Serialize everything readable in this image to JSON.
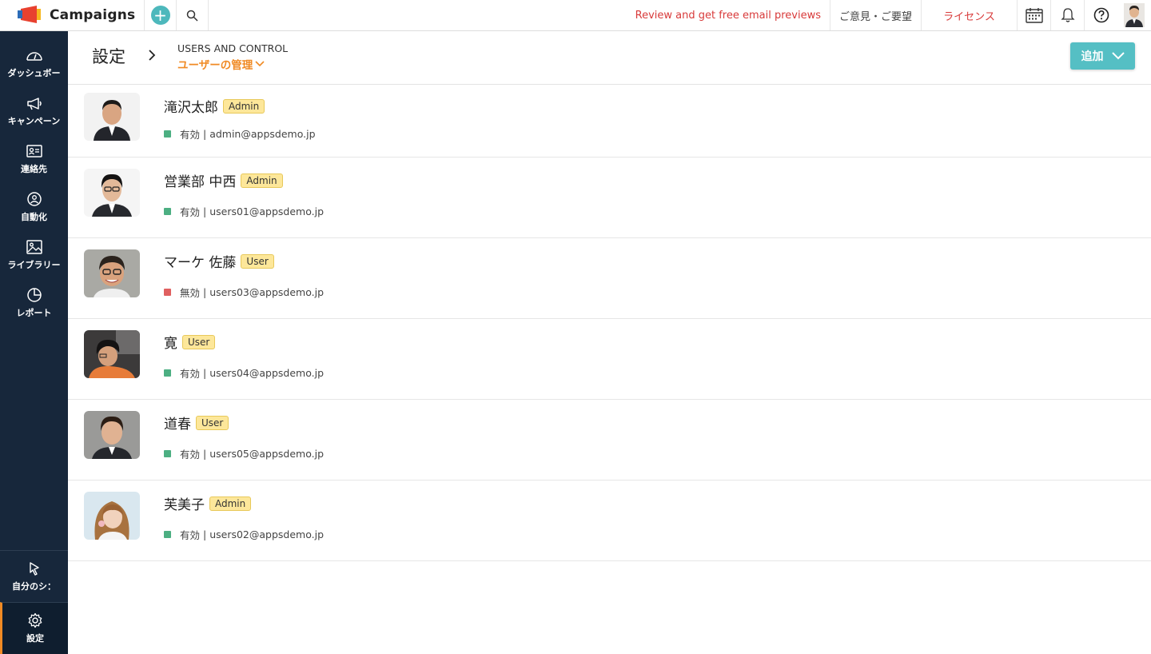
{
  "topbar": {
    "app_name": "Campaigns",
    "promo_link": "Review and get free email previews",
    "feedback": "ご意見・ご要望",
    "license": "ライセンス",
    "accent_color": "#4db8bc",
    "alert_color": "#d83a3a"
  },
  "sidebar": {
    "items": [
      {
        "label": "ダッシュボー",
        "icon": "dashboard-icon"
      },
      {
        "label": "キャンペーン",
        "icon": "megaphone-icon"
      },
      {
        "label": "連絡先",
        "icon": "contact-card-icon"
      },
      {
        "label": "自動化",
        "icon": "automation-icon"
      },
      {
        "label": "ライブラリー",
        "icon": "image-library-icon"
      },
      {
        "label": "レポート",
        "icon": "pie-chart-icon"
      }
    ],
    "bottom": [
      {
        "label": "自分のシ：",
        "icon": "pointer-icon"
      },
      {
        "label": "設定",
        "icon": "gear-icon"
      }
    ],
    "active_color": "#f08a24"
  },
  "header": {
    "title": "設定",
    "section": "USERS AND CONTROL",
    "subsection": "ユーザーの管理",
    "add_button": "追加"
  },
  "users": [
    {
      "name": "滝沢太郎",
      "role": "Admin",
      "status": "有効",
      "email": "admin@appsdemo.jp",
      "status_color": "#4caf82"
    },
    {
      "name": "営業部 中西",
      "role": "Admin",
      "status": "有効",
      "email": "users01@appsdemo.jp",
      "status_color": "#4caf82"
    },
    {
      "name": "マーケ 佐藤",
      "role": "User",
      "status": "無効",
      "email": "users03@appsdemo.jp",
      "status_color": "#e06060"
    },
    {
      "name": "寛",
      "role": "User",
      "status": "有効",
      "email": "users04@appsdemo.jp",
      "status_color": "#4caf82"
    },
    {
      "name": "道春",
      "role": "User",
      "status": "有効",
      "email": "users05@appsdemo.jp",
      "status_color": "#4caf82"
    },
    {
      "name": "芙美子",
      "role": "Admin",
      "status": "有効",
      "email": "users02@appsdemo.jp",
      "status_color": "#4caf82"
    }
  ],
  "separator": " | "
}
